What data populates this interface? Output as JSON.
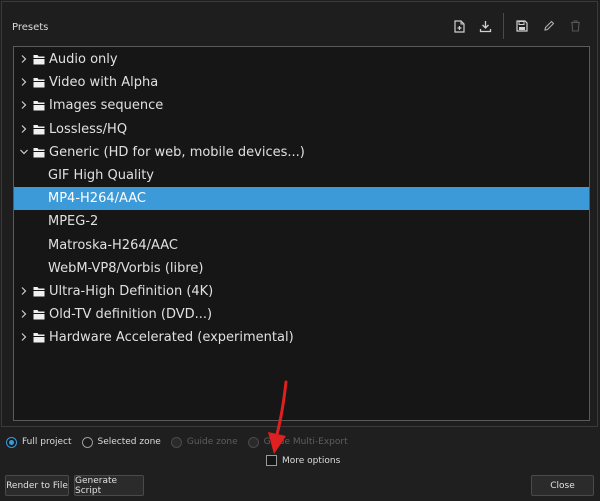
{
  "panel": {
    "title": "Presets"
  },
  "toolbar": [
    {
      "name": "new-preset-icon"
    },
    {
      "name": "download-preset-icon"
    },
    {
      "name": "save-preset-icon"
    },
    {
      "name": "edit-preset-icon"
    },
    {
      "name": "delete-preset-icon",
      "disabled": true
    }
  ],
  "tree": {
    "items": [
      {
        "label": "Audio only",
        "type": "group",
        "expanded": false
      },
      {
        "label": "Video with Alpha",
        "type": "group",
        "expanded": false
      },
      {
        "label": "Images sequence",
        "type": "group",
        "expanded": false
      },
      {
        "label": "Lossless/HQ",
        "type": "group",
        "expanded": false
      },
      {
        "label": "Generic (HD for web, mobile devices...)",
        "type": "group",
        "expanded": true
      },
      {
        "label": "GIF High Quality",
        "type": "child"
      },
      {
        "label": "MP4-H264/AAC",
        "type": "child",
        "selected": true
      },
      {
        "label": "MPEG-2",
        "type": "child"
      },
      {
        "label": "Matroska-H264/AAC",
        "type": "child"
      },
      {
        "label": "WebM-VP8/Vorbis (libre)",
        "type": "child"
      },
      {
        "label": "Ultra-High Definition (4K)",
        "type": "group",
        "expanded": false
      },
      {
        "label": "Old-TV definition (DVD...)",
        "type": "group",
        "expanded": false
      },
      {
        "label": "Hardware Accelerated (experimental)",
        "type": "group",
        "expanded": false
      }
    ]
  },
  "range": {
    "options": [
      {
        "label": "Full project",
        "checked": true,
        "disabled": false
      },
      {
        "label": "Selected zone",
        "checked": false,
        "disabled": false
      },
      {
        "label": "Guide zone",
        "checked": false,
        "disabled": true
      },
      {
        "label": "Guide Multi-Export",
        "checked": false,
        "disabled": true
      }
    ]
  },
  "more_options": {
    "label": "More options",
    "checked": false
  },
  "buttons": {
    "render": "Render to File",
    "script": "Generate Script",
    "close": "Close"
  },
  "colors": {
    "selection": "#3c9ad8",
    "annotation_arrow": "#e02020"
  }
}
